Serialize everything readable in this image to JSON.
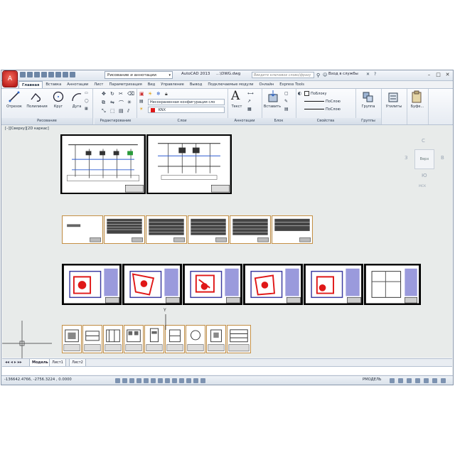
{
  "app": {
    "title": "AutoCAD 2013",
    "file": "...\\DWG.dwg",
    "workspace": "Рисование и аннотации",
    "search_placeholder": "Введите ключевое слово/фразу",
    "login": "Вход в службы",
    "logo": "A"
  },
  "tabs": [
    "Главная",
    "Вставка",
    "Аннотации",
    "Лист",
    "Параметризация",
    "Вид",
    "Управление",
    "Вывод",
    "Подключаемые модули",
    "Онлайн",
    "Express Tools"
  ],
  "ribbon": {
    "draw": {
      "label": "Рисование",
      "tools": [
        "Отрезок",
        "Полилиния",
        "Круг",
        "Дуга"
      ]
    },
    "modify": {
      "label": "Редактирование"
    },
    "layers": {
      "label": "Слои",
      "state": "Несохраненная конфигурация сло",
      "layer": "KNX"
    },
    "annotation": {
      "label": "Аннотации",
      "text": "Текст"
    },
    "block": {
      "label": "Блок",
      "insert": "Вставить"
    },
    "properties": {
      "label": "Свойства",
      "color": "ПоБлоку",
      "linetype": "ПоСлою",
      "lineweight": "ПоСлою"
    },
    "groups": {
      "label": "Группы",
      "group": "Группа"
    },
    "utilities": {
      "label": "Утилиты"
    },
    "clipboard": {
      "label": "Буфе..."
    }
  },
  "viewport": {
    "label": "[–][Сверху][2D каркас]",
    "cube": {
      "top": "Верх",
      "n": "С",
      "s": "Ю",
      "w": "З",
      "e": "В",
      "wcs": "МСК"
    }
  },
  "ucs": {
    "y": "Y"
  },
  "layout_tabs": [
    "Модель",
    "Лист1",
    "Лист2"
  ],
  "status": {
    "coords": "-136642.4766, -2756.3224 , 0.0000",
    "mode": "РМОДЕЛЬ"
  }
}
